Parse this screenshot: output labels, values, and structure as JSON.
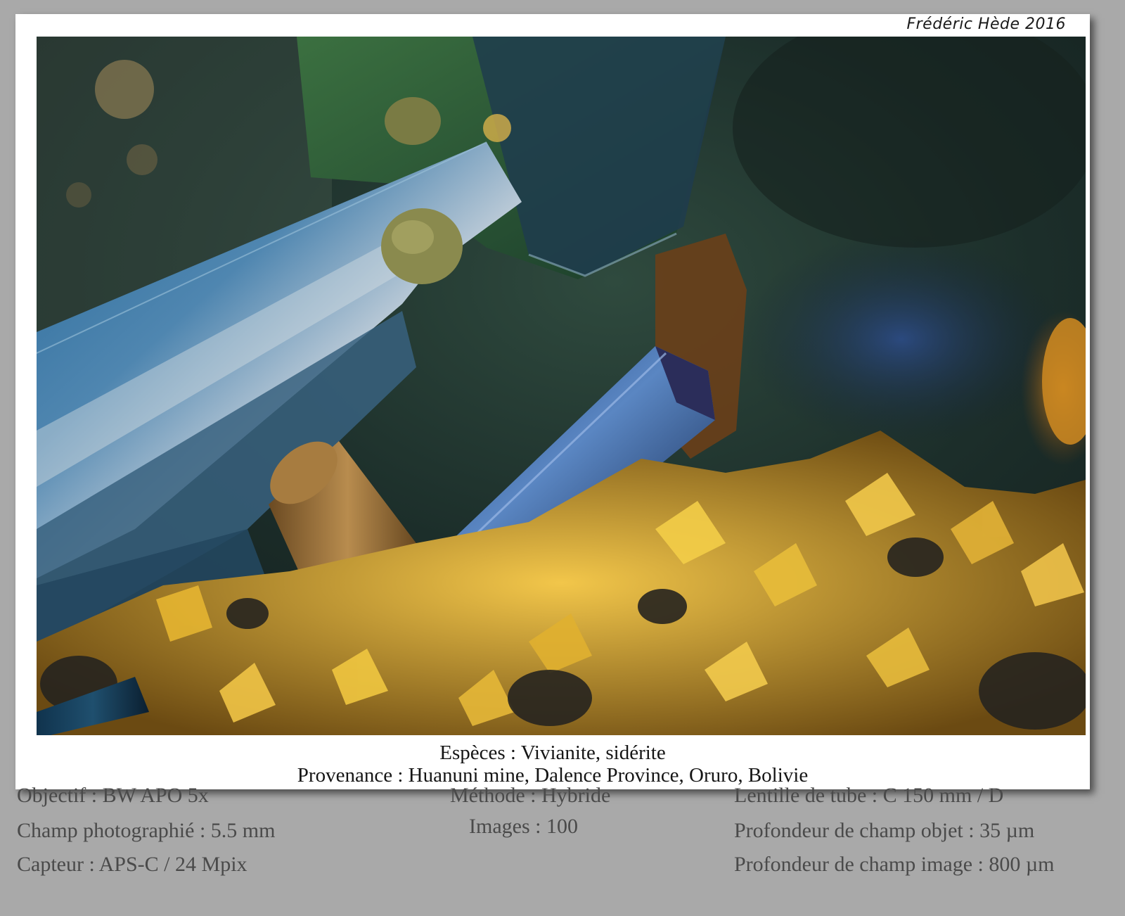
{
  "credit": "Frédéric Hède 2016",
  "photo": {
    "subject": "macro photograph of blue vivianite and golden siderite crystals"
  },
  "captions": {
    "species": "Espèces : Vivianite, sidérite",
    "provenance": "Provenance : Huanuni mine, Dalence Province, Oruro, Bolivie"
  },
  "specs": {
    "objectif": "Objectif : BW APO 5x",
    "champ": "Champ photographié : 5.5 mm",
    "capteur": "Capteur : APS-C / 24 Mpix",
    "methode": "Méthode : Hybride",
    "images": "Images : 100",
    "lentille": "Lentille de tube : C 150 mm / D",
    "profondeur_objet": "Profondeur de champ objet : 35 µm",
    "profondeur_image": "Profondeur de champ image : 800 µm"
  },
  "colors": {
    "background": "#a9a9a9",
    "card": "#ffffff",
    "vivianite_blue": "#1d4f8a",
    "siderite_gold": "#d9a826"
  }
}
